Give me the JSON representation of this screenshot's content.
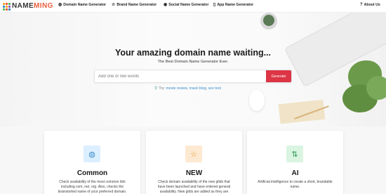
{
  "brand": {
    "name_part1": "NAME",
    "name_part2": "MING",
    "grid_colors": [
      "#f4a62a",
      "#e85d3c",
      "#5bb85d",
      "#3a8bc8",
      "#f4a62a",
      "#9b59b6",
      "#5bb85d",
      "#e85d3c",
      "#3a8bc8"
    ]
  },
  "nav": {
    "items": [
      {
        "label": "Domain Name Generator",
        "icon": "globe-icon",
        "glyph": "◍"
      },
      {
        "label": "Brand Name Generator",
        "icon": "star-icon",
        "glyph": "☆"
      },
      {
        "label": "Social Name Generator",
        "icon": "user-icon",
        "glyph": "◉"
      },
      {
        "label": "App Name Generator",
        "icon": "mobile-icon",
        "glyph": "▯"
      },
      {
        "label": "About Us",
        "icon": "question-icon",
        "glyph": "?"
      }
    ]
  },
  "hero": {
    "title": "Your amazing domain name waiting...",
    "subtitle": "The Best Domain Name Generator Ever.",
    "search_placeholder": "Add one or two words",
    "generate_label": "Generate",
    "try_label": "Try:",
    "try_links": [
      "movie review",
      "travel blog",
      "seo tool"
    ]
  },
  "cards": [
    {
      "title": "Common",
      "icon": "globe-icon",
      "glyph": "◍",
      "icon_bg": "#dcefff",
      "icon_color": "#3a8bc8",
      "text": "Check availability of the most common tlds including com, net, org. Also, checks the brainstorted name of your preferred domain."
    },
    {
      "title": "NEW",
      "icon": "star-icon",
      "glyph": "☆",
      "icon_bg": "#fde9d2",
      "icon_color": "#e88a1a",
      "text": "Check domain availability of the new gtlds that have been launched and have entered general availability. New gtlds are added as they are"
    },
    {
      "title": "AI",
      "icon": "sort-icon",
      "glyph": "⇅",
      "icon_bg": "#daf4e2",
      "icon_color": "#2e9a4f",
      "text": "Artificial intelligence to create a short, brandable name."
    }
  ],
  "colors": {
    "accent": "#dc3545",
    "link": "#3a8bc8",
    "brand_highlight": "#e85d3c"
  }
}
